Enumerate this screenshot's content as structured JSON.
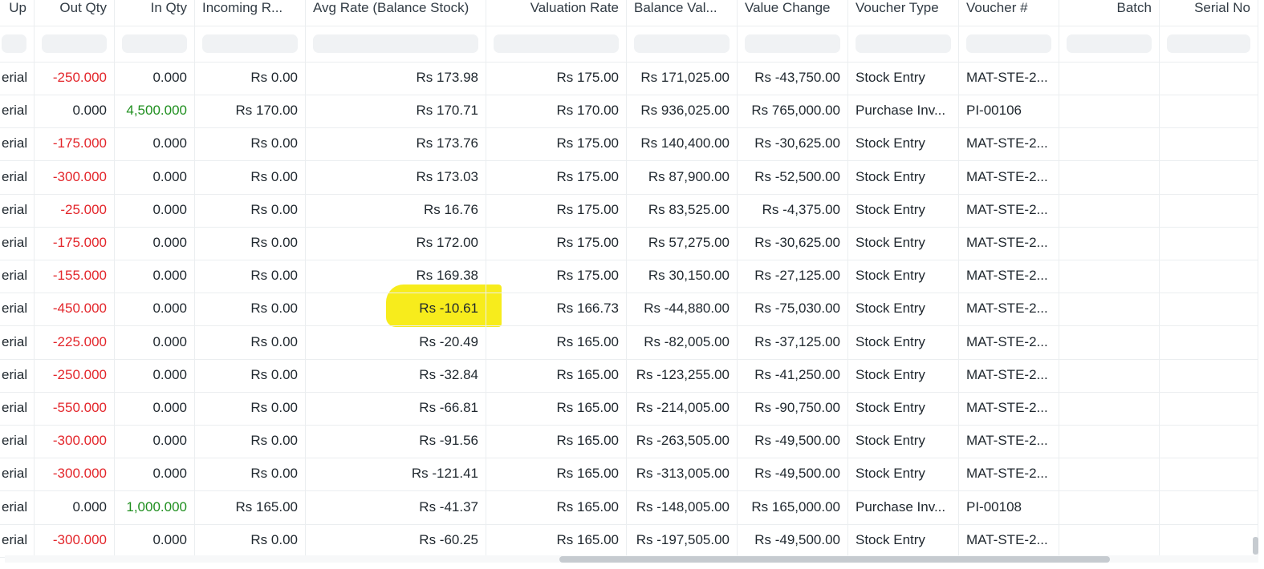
{
  "columns": [
    "Up",
    "Out Qty",
    "In Qty",
    "Incoming R...",
    "Avg Rate (Balance Stock)",
    "Valuation Rate",
    "Balance Val...",
    "Value Change",
    "Voucher Type",
    "Voucher #",
    "Batch",
    "Serial No"
  ],
  "rows": [
    {
      "col0": "erial",
      "out_qty": "-250.000",
      "in_qty": "0.000",
      "incoming_rate": "Rs 0.00",
      "avg_rate": "Rs 173.98",
      "valuation_rate": "Rs 175.00",
      "balance_value": "Rs 171,025.00",
      "value_change": "Rs -43,750.00",
      "voucher_type": "Stock Entry",
      "voucher_no": "MAT-STE-2...",
      "batch": "",
      "serial_no": ""
    },
    {
      "col0": "erial",
      "out_qty": "0.000",
      "in_qty": "4,500.000",
      "incoming_rate": "Rs 170.00",
      "avg_rate": "Rs 170.71",
      "valuation_rate": "Rs 170.00",
      "balance_value": "Rs 936,025.00",
      "value_change": "Rs 765,000.00",
      "voucher_type": "Purchase Inv...",
      "voucher_no": "PI-00106",
      "batch": "",
      "serial_no": ""
    },
    {
      "col0": "erial",
      "out_qty": "-175.000",
      "in_qty": "0.000",
      "incoming_rate": "Rs 0.00",
      "avg_rate": "Rs 173.76",
      "valuation_rate": "Rs 175.00",
      "balance_value": "Rs 140,400.00",
      "value_change": "Rs -30,625.00",
      "voucher_type": "Stock Entry",
      "voucher_no": "MAT-STE-2...",
      "batch": "",
      "serial_no": ""
    },
    {
      "col0": "erial",
      "out_qty": "-300.000",
      "in_qty": "0.000",
      "incoming_rate": "Rs 0.00",
      "avg_rate": "Rs 173.03",
      "valuation_rate": "Rs 175.00",
      "balance_value": "Rs 87,900.00",
      "value_change": "Rs -52,500.00",
      "voucher_type": "Stock Entry",
      "voucher_no": "MAT-STE-2...",
      "batch": "",
      "serial_no": ""
    },
    {
      "col0": "erial",
      "out_qty": "-25.000",
      "in_qty": "0.000",
      "incoming_rate": "Rs 0.00",
      "avg_rate": "Rs 16.76",
      "valuation_rate": "Rs 175.00",
      "balance_value": "Rs 83,525.00",
      "value_change": "Rs -4,375.00",
      "voucher_type": "Stock Entry",
      "voucher_no": "MAT-STE-2...",
      "batch": "",
      "serial_no": ""
    },
    {
      "col0": "erial",
      "out_qty": "-175.000",
      "in_qty": "0.000",
      "incoming_rate": "Rs 0.00",
      "avg_rate": "Rs 172.00",
      "valuation_rate": "Rs 175.00",
      "balance_value": "Rs 57,275.00",
      "value_change": "Rs -30,625.00",
      "voucher_type": "Stock Entry",
      "voucher_no": "MAT-STE-2...",
      "batch": "",
      "serial_no": ""
    },
    {
      "col0": "erial",
      "out_qty": "-155.000",
      "in_qty": "0.000",
      "incoming_rate": "Rs 0.00",
      "avg_rate": "Rs 169.38",
      "valuation_rate": "Rs 175.00",
      "balance_value": "Rs 30,150.00",
      "value_change": "Rs -27,125.00",
      "voucher_type": "Stock Entry",
      "voucher_no": "MAT-STE-2...",
      "batch": "",
      "serial_no": ""
    },
    {
      "col0": "erial",
      "out_qty": "-450.000",
      "in_qty": "0.000",
      "incoming_rate": "Rs 0.00",
      "avg_rate": "Rs -10.61",
      "valuation_rate": "Rs 166.73",
      "balance_value": "Rs -44,880.00",
      "value_change": "Rs -75,030.00",
      "voucher_type": "Stock Entry",
      "voucher_no": "MAT-STE-2...",
      "batch": "",
      "serial_no": ""
    },
    {
      "col0": "erial",
      "out_qty": "-225.000",
      "in_qty": "0.000",
      "incoming_rate": "Rs 0.00",
      "avg_rate": "Rs -20.49",
      "valuation_rate": "Rs 165.00",
      "balance_value": "Rs -82,005.00",
      "value_change": "Rs -37,125.00",
      "voucher_type": "Stock Entry",
      "voucher_no": "MAT-STE-2...",
      "batch": "",
      "serial_no": ""
    },
    {
      "col0": "erial",
      "out_qty": "-250.000",
      "in_qty": "0.000",
      "incoming_rate": "Rs 0.00",
      "avg_rate": "Rs -32.84",
      "valuation_rate": "Rs 165.00",
      "balance_value": "Rs -123,255.00",
      "value_change": "Rs -41,250.00",
      "voucher_type": "Stock Entry",
      "voucher_no": "MAT-STE-2...",
      "batch": "",
      "serial_no": ""
    },
    {
      "col0": "erial",
      "out_qty": "-550.000",
      "in_qty": "0.000",
      "incoming_rate": "Rs 0.00",
      "avg_rate": "Rs -66.81",
      "valuation_rate": "Rs 165.00",
      "balance_value": "Rs -214,005.00",
      "value_change": "Rs -90,750.00",
      "voucher_type": "Stock Entry",
      "voucher_no": "MAT-STE-2...",
      "batch": "",
      "serial_no": ""
    },
    {
      "col0": "erial",
      "out_qty": "-300.000",
      "in_qty": "0.000",
      "incoming_rate": "Rs 0.00",
      "avg_rate": "Rs -91.56",
      "valuation_rate": "Rs 165.00",
      "balance_value": "Rs -263,505.00",
      "value_change": "Rs -49,500.00",
      "voucher_type": "Stock Entry",
      "voucher_no": "MAT-STE-2...",
      "batch": "",
      "serial_no": ""
    },
    {
      "col0": "erial",
      "out_qty": "-300.000",
      "in_qty": "0.000",
      "incoming_rate": "Rs 0.00",
      "avg_rate": "Rs -121.41",
      "valuation_rate": "Rs 165.00",
      "balance_value": "Rs -313,005.00",
      "value_change": "Rs -49,500.00",
      "voucher_type": "Stock Entry",
      "voucher_no": "MAT-STE-2...",
      "batch": "",
      "serial_no": ""
    },
    {
      "col0": "erial",
      "out_qty": "0.000",
      "in_qty": "1,000.000",
      "incoming_rate": "Rs 165.00",
      "avg_rate": "Rs -41.37",
      "valuation_rate": "Rs 165.00",
      "balance_value": "Rs -148,005.00",
      "value_change": "Rs 165,000.00",
      "voucher_type": "Purchase Inv...",
      "voucher_no": "PI-00108",
      "batch": "",
      "serial_no": ""
    },
    {
      "col0": "erial",
      "out_qty": "-300.000",
      "in_qty": "0.000",
      "incoming_rate": "Rs 0.00",
      "avg_rate": "Rs -60.25",
      "valuation_rate": "Rs 165.00",
      "balance_value": "Rs -197,505.00",
      "value_change": "Rs -49,500.00",
      "voucher_type": "Stock Entry",
      "voucher_no": "MAT-STE-2...",
      "batch": "",
      "serial_no": ""
    }
  ],
  "highlight": {
    "row_index": 7,
    "column": "avg_rate",
    "color": "#f7ec1c"
  },
  "colors": {
    "negative": "#e3262b",
    "positive": "#1f8f1f",
    "text": "#1f272e",
    "border": "#ebeef0"
  }
}
